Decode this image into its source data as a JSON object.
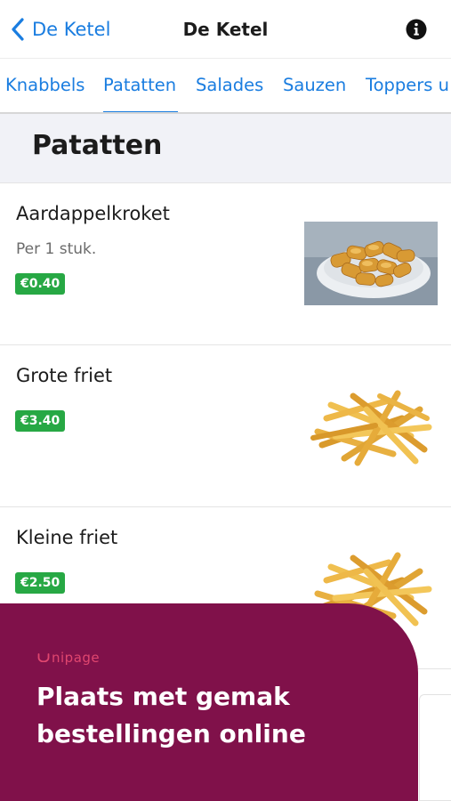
{
  "nav": {
    "back_label": "De Ketel",
    "title": "De Ketel",
    "info_icon": "info-icon"
  },
  "tabs": [
    {
      "label": "Knabbels",
      "active": false
    },
    {
      "label": "Patatten",
      "active": true
    },
    {
      "label": "Salades",
      "active": false
    },
    {
      "label": "Sauzen",
      "active": false
    },
    {
      "label": "Toppers u",
      "active": false
    }
  ],
  "section": {
    "title": "Patatten"
  },
  "items": [
    {
      "name": "Aardappelkroket",
      "description": "Per 1 stuk.",
      "price": "€0.40",
      "image": "croquettes-photo"
    },
    {
      "name": "Grote friet",
      "description": "",
      "price": "€3.40",
      "image": "fries-photo"
    },
    {
      "name": "Kleine friet",
      "description": "",
      "price": "€2.50",
      "image": "fries-photo"
    }
  ],
  "promo": {
    "brand": "nipage",
    "headline": "Plaats met gemak bestellingen online"
  },
  "colors": {
    "accent": "#1a7de0",
    "price_badge": "#27a844",
    "promo_bg": "#80114a",
    "promo_logo": "#e0466f"
  }
}
